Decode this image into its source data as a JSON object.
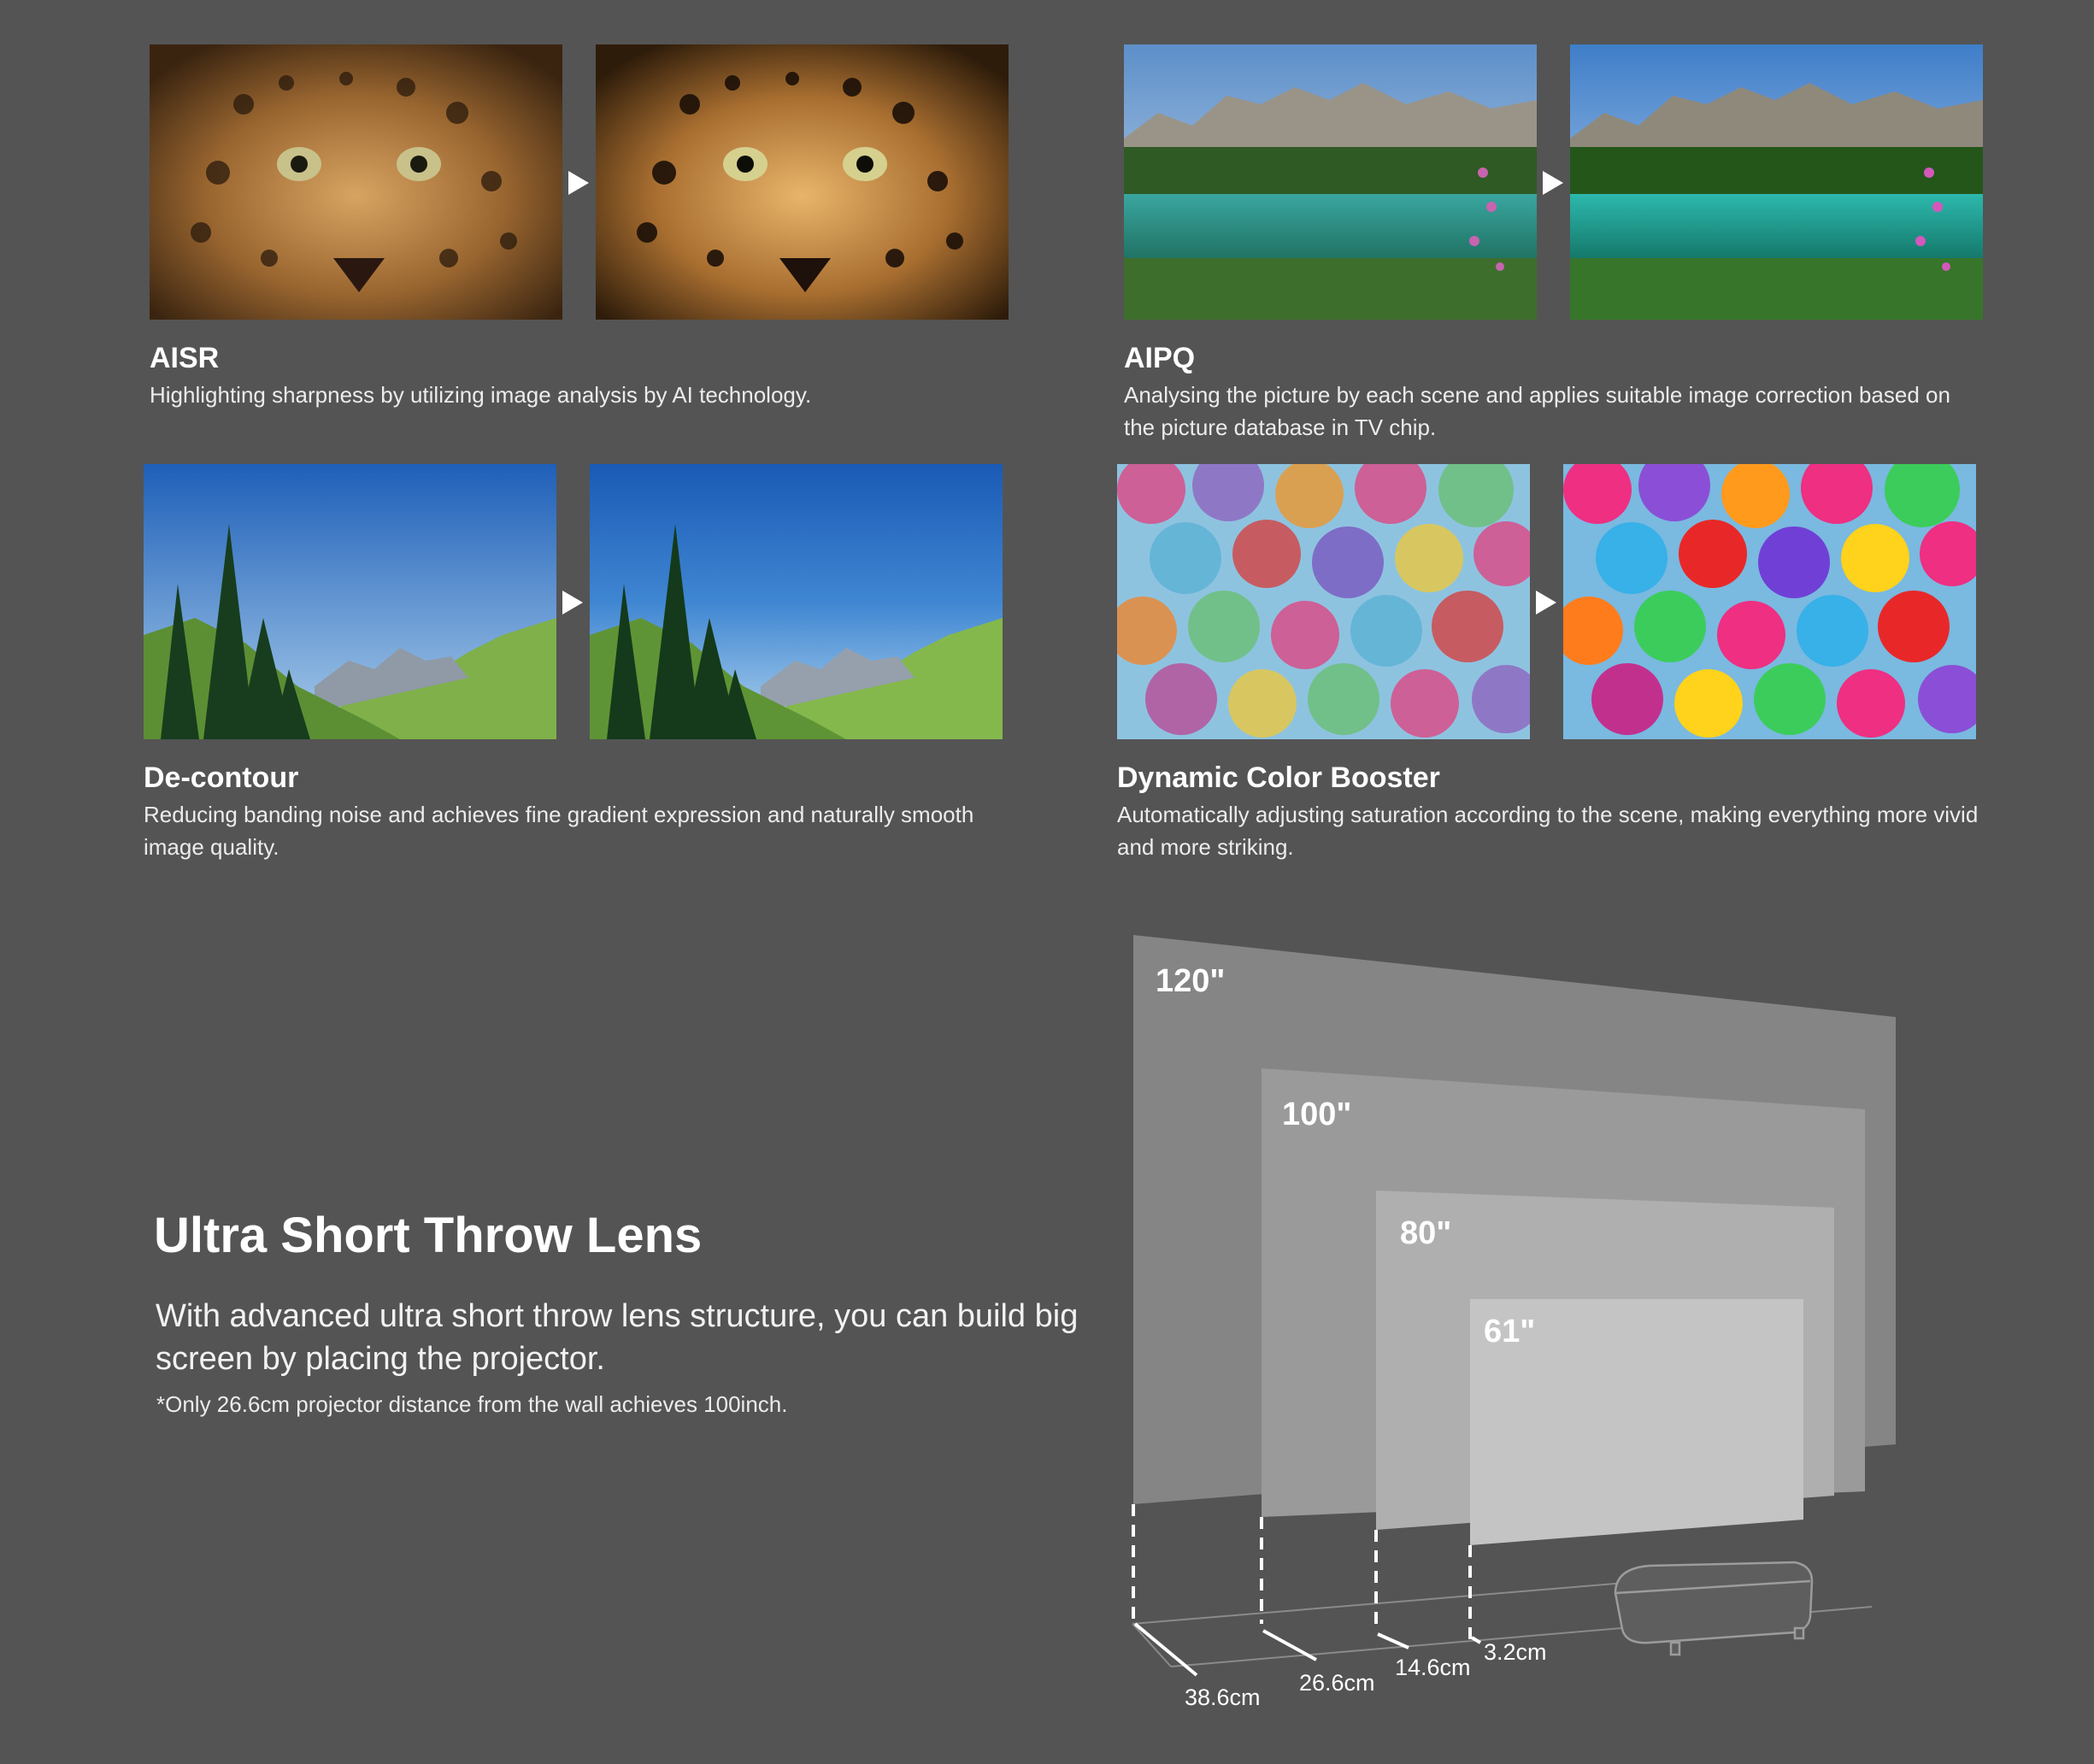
{
  "features": [
    {
      "title": "AISR",
      "description": "Highlighting sharpness by utilizing image analysis by AI technology.",
      "image": "leopard-photo"
    },
    {
      "title": "AIPQ",
      "description": "Analysing the picture by each scene and applies suitable image correction based on the picture database in TV chip.",
      "image": "mountain-lake-photo"
    },
    {
      "title": "De-contour",
      "description": "Reducing banding noise and achieves fine gradient expression and naturally smooth image quality.",
      "image": "forest-valley-photo"
    },
    {
      "title": "Dynamic Color Booster",
      "description": "Automatically adjusting saturation according to the scene, making everything more vivid and more striking.",
      "image": "umbrellas-photo"
    }
  ],
  "ust": {
    "title": "Ultra Short Throw Lens",
    "description": "With advanced ultra short throw lens structure, you can build big screen by placing the projector.",
    "note": "*Only 26.6cm projector distance from the wall achieves 100inch."
  },
  "diagram": {
    "screen_sizes": [
      "120\"",
      "100\"",
      "80\"",
      "61\""
    ],
    "distances": [
      "38.6cm",
      "26.6cm",
      "14.6cm",
      "3.2cm"
    ]
  }
}
